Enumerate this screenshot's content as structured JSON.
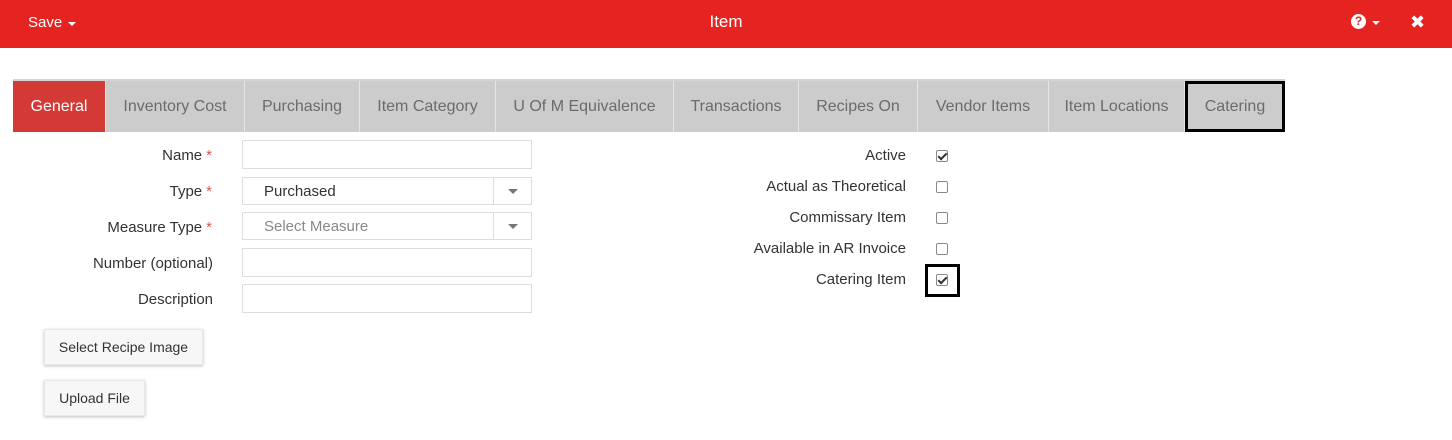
{
  "header": {
    "save_label": "Save",
    "title": "Item",
    "help_glyph": "?",
    "close_glyph": "✖",
    "accent_color": "#e52421"
  },
  "tabs": [
    {
      "label": "General",
      "active": true
    },
    {
      "label": "Inventory Cost"
    },
    {
      "label": "Purchasing"
    },
    {
      "label": "Item Category"
    },
    {
      "label": "U Of M Equivalence"
    },
    {
      "label": "Transactions"
    },
    {
      "label": "Recipes On"
    },
    {
      "label": "Vendor Items"
    },
    {
      "label": "Item Locations"
    },
    {
      "label": "Catering",
      "highlighted": true
    }
  ],
  "form": {
    "name_label": "Name",
    "name_value": "",
    "type_label": "Type",
    "type_value": "Purchased",
    "measure_label": "Measure Type",
    "measure_placeholder": "Select Measure",
    "number_label": "Number (optional)",
    "number_value": "",
    "description_label": "Description",
    "description_value": "",
    "required_mark": "*",
    "select_recipe_image_label": "Select Recipe Image",
    "upload_file_label": "Upload File"
  },
  "flags": [
    {
      "label": "Active",
      "checked": true
    },
    {
      "label": "Actual as Theoretical",
      "checked": false
    },
    {
      "label": "Commissary Item",
      "checked": false
    },
    {
      "label": "Available in AR Invoice",
      "checked": false
    },
    {
      "label": "Catering Item",
      "checked": true,
      "highlighted": true
    }
  ]
}
